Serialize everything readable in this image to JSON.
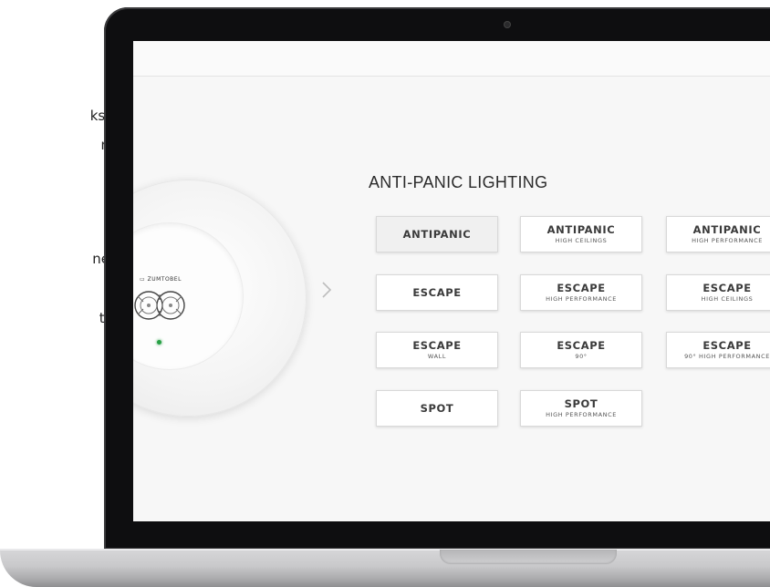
{
  "background_text": [
    "ks,",
    "n",
    ".",
    "ne",
    "t-"
  ],
  "lamp": {
    "brand": "ZUMTOBEL",
    "brand_prefix": "▭"
  },
  "section": {
    "title": "ANTI-PANIC LIGHTING"
  },
  "options": [
    {
      "label": "ANTIPANIC",
      "sub": "",
      "active": true
    },
    {
      "label": "ANTIPANIC",
      "sub": "HIGH CEILINGS",
      "active": false
    },
    {
      "label": "ANTIPANIC",
      "sub": "HIGH PERFORMANCE",
      "active": false
    },
    {
      "label": "ESCAPE",
      "sub": "",
      "active": false
    },
    {
      "label": "ESCAPE",
      "sub": "HIGH PERFORMANCE",
      "active": false
    },
    {
      "label": "ESCAPE",
      "sub": "HIGH CEILINGS",
      "active": false
    },
    {
      "label": "ESCAPE",
      "sub": "WALL",
      "active": false
    },
    {
      "label": "ESCAPE",
      "sub": "90°",
      "active": false
    },
    {
      "label": "ESCAPE",
      "sub": "90° HIGH PERFORMANCE",
      "active": false
    },
    {
      "label": "SPOT",
      "sub": "",
      "active": false
    },
    {
      "label": "SPOT",
      "sub": "HIGH PERFORMANCE",
      "active": false
    }
  ],
  "icons": {
    "next": "chevron-right-icon",
    "camera": "camera-icon"
  },
  "colors": {
    "led": "#27a045",
    "screen_bg": "#f7f7f7",
    "button_border": "#d9d9d9"
  }
}
